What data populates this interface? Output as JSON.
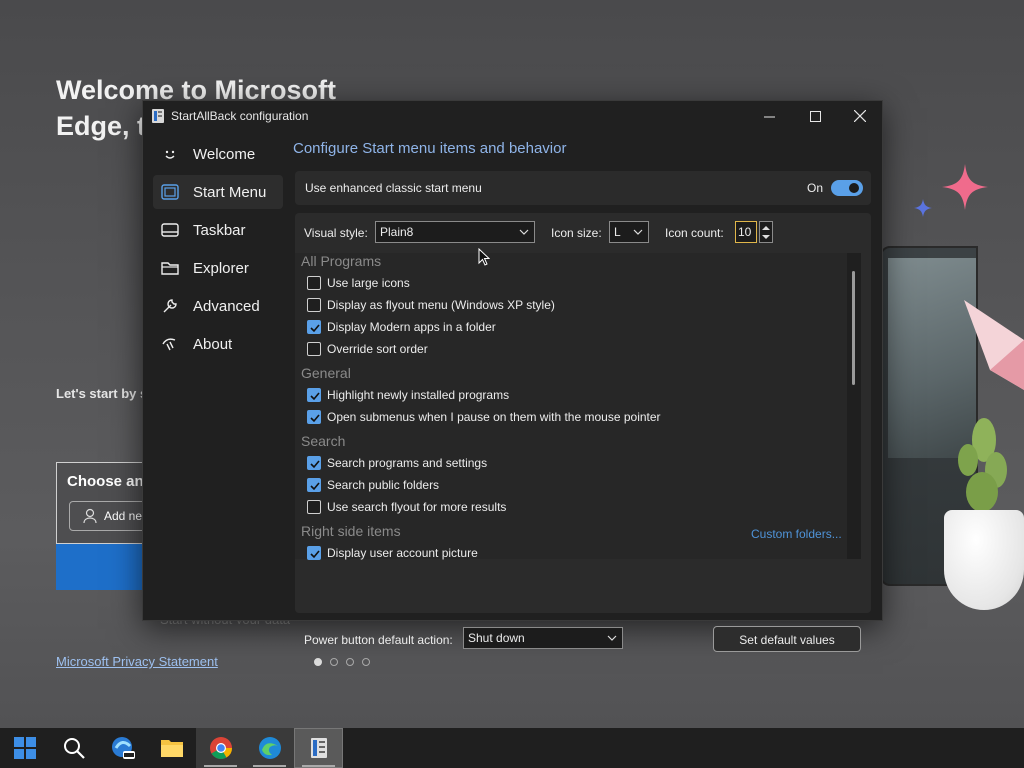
{
  "background": {
    "headline": "Welcome to Microsoft Edge, the browser",
    "sub": "Let's start by signing in: passwords, history",
    "choose_title": "Choose an",
    "add_label": "Add new",
    "start_without": "Start without your data",
    "privacy_link": "Microsoft Privacy Statement"
  },
  "window": {
    "title": "StartAllBack configuration",
    "controls": {
      "minimize": "minimize",
      "maximize": "maximize",
      "close": "close"
    }
  },
  "nav": {
    "items": [
      {
        "label": "Welcome",
        "icon": "smiley-icon"
      },
      {
        "label": "Start Menu",
        "icon": "start-menu-icon"
      },
      {
        "label": "Taskbar",
        "icon": "taskbar-icon"
      },
      {
        "label": "Explorer",
        "icon": "folder-icon"
      },
      {
        "label": "Advanced",
        "icon": "wrench-icon"
      },
      {
        "label": "About",
        "icon": "about-icon"
      }
    ],
    "active": "Start Menu"
  },
  "content": {
    "heading": "Configure Start menu items and behavior",
    "enhanced": {
      "label": "Use enhanced classic start menu",
      "state": "On",
      "enabled": true
    },
    "visual_style": {
      "label": "Visual style:",
      "value": "Plain8"
    },
    "icon_size": {
      "label": "Icon size:",
      "value": "L"
    },
    "icon_count": {
      "label": "Icon count:",
      "value": "10"
    },
    "sections": {
      "all_programs": "All Programs",
      "general": "General",
      "search": "Search",
      "right_side": "Right side items"
    },
    "options": {
      "large_icons": {
        "label": "Use large icons",
        "checked": false
      },
      "flyout": {
        "label": "Display as flyout menu (Windows XP style)",
        "checked": false
      },
      "modern_folder": {
        "label": "Display Modern apps in a folder",
        "checked": true
      },
      "sort_order": {
        "label": "Override sort order",
        "checked": false
      },
      "highlight_new": {
        "label": "Highlight newly installed programs",
        "checked": true
      },
      "submenus_pause": {
        "label": "Open submenus when I pause on them with the mouse pointer",
        "checked": true
      },
      "search_programs": {
        "label": "Search programs and settings",
        "checked": true
      },
      "search_public": {
        "label": "Search public folders",
        "checked": true
      },
      "search_flyout": {
        "label": "Use search flyout for more results",
        "checked": false
      },
      "user_picture": {
        "label": "Display user account picture",
        "checked": true
      }
    },
    "custom_folders": "Custom folders...",
    "power": {
      "label": "Power button default action:",
      "value": "Shut down"
    },
    "default_button": "Set default values"
  },
  "colors": {
    "accent": "#5aa0e8",
    "heading": "#8fb4e8",
    "link": "#4f93d8",
    "window_bg": "#202020",
    "panel_bg": "#2b2b2b"
  }
}
